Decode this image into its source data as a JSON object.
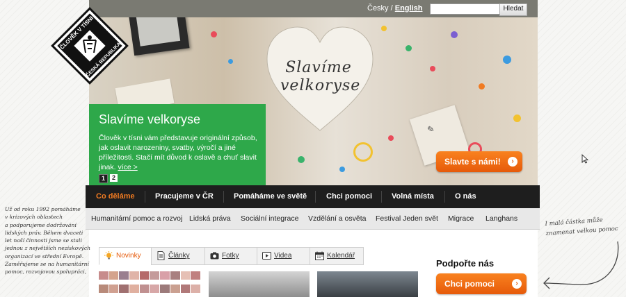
{
  "header": {
    "lang_cz": "Česky",
    "lang_sep": " / ",
    "lang_en": "English",
    "search_placeholder": "",
    "search_button": "Hledat"
  },
  "logo": {
    "top_text": "ČLOVĚK V TÍSNI",
    "bottom_text": "ČESKÁ REPUBLIKA"
  },
  "hero": {
    "heart_text_line1": "Slavíme",
    "heart_text_line2": "velkoryse",
    "callout_title": "Slavíme velkoryse",
    "callout_text": "Člověk v tísni vám představuje originální způsob, jak oslavit narozeniny, svatby, výročí a jiné příležitosti. Stačí mít důvod k oslavě a chuť slavit jinak.",
    "callout_more": "více >",
    "pager": [
      "1",
      "2"
    ],
    "cta_label": "Slavte s námi!"
  },
  "main_nav": [
    {
      "label": "Co děláme",
      "active": true
    },
    {
      "label": "Pracujeme v ČR",
      "active": false
    },
    {
      "label": "Pomáháme ve světě",
      "active": false
    },
    {
      "label": "Chci pomoci",
      "active": false
    },
    {
      "label": "Volná místa",
      "active": false
    },
    {
      "label": "O nás",
      "active": false
    }
  ],
  "sub_nav": [
    "Humanitární pomoc a rozvoj",
    "Lidská práva",
    "Sociální integrace",
    "Vzdělání a osvěta",
    "Festival Jeden svět",
    "Migrace",
    "Langhans"
  ],
  "tabs": [
    {
      "label": "Novinky",
      "icon": "bulb-icon",
      "active": true
    },
    {
      "label": "Články",
      "icon": "document-icon",
      "active": false
    },
    {
      "label": "Fotky",
      "icon": "camera-icon",
      "active": false
    },
    {
      "label": "Videa",
      "icon": "play-icon",
      "active": false
    },
    {
      "label": "Kalendář",
      "icon": "calendar-icon",
      "active": false
    }
  ],
  "support": {
    "title": "Podpořte nás",
    "button": "Chci pomoci"
  },
  "side_note_lines": [
    "Už od roku 1992 pomáháme",
    "v krizových oblastech",
    "a podporujeme dodržování",
    "lidských práv. Během dvaceti",
    "let naší činnosti jsme se stali",
    "jednou z největších neziskových",
    "organizací ve střední Evropě.",
    "Zaměřujeme se na humanitární",
    "pomoc, rozvojovou spolupráci,"
  ],
  "right_note_lines": [
    "I malá částka může",
    "znamenat velkou pomoc"
  ],
  "colors": {
    "accent_orange": "#e65a0a",
    "green": "#2ea84a",
    "nav_dark": "#1e1e1e"
  }
}
